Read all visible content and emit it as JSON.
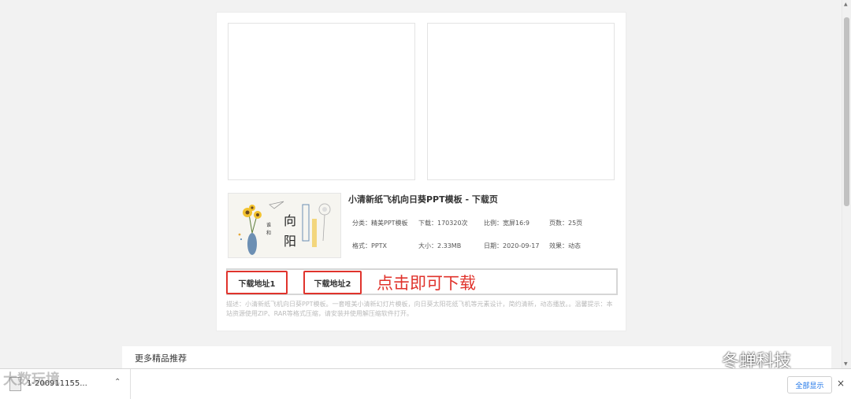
{
  "product": {
    "title": "小清新纸飞机向日葵PPT模板 - 下载页",
    "category": "分类：精美PPT模板",
    "downloads": "下载：170320次",
    "ratio": "比例：宽屏16:9",
    "pages": "页数：25页",
    "format": "格式：PPTX",
    "size": "大小：2.33MB",
    "date": "日期：2020-09-17",
    "effect": "效果：动态",
    "thumbnail_chars": [
      "向",
      "阳"
    ]
  },
  "download": {
    "button1_label": "下载地址1",
    "button2_label": "下载地址2",
    "annotation": "点击即可下载"
  },
  "description": "描述：小清新纸飞机向日葵PPT模板。一套唯美小清新幻灯片模板，向日葵太阳花纸飞机等元素设计，简约清新，动态播放。。温馨提示：本站资源使用ZIP、RAR等格式压缩，请安装并使用解压缩软件打开。",
  "more_section": {
    "title": "更多精品推荐"
  },
  "download_shelf": {
    "file_label": "1-200911155...",
    "show_all_label": "全部显示",
    "close_label": "×"
  },
  "watermarks": {
    "left": "大数玩境",
    "right": "冬蝉科技"
  },
  "colors": {
    "accent_red": "#e0332c",
    "link_blue": "#1a73e8"
  }
}
